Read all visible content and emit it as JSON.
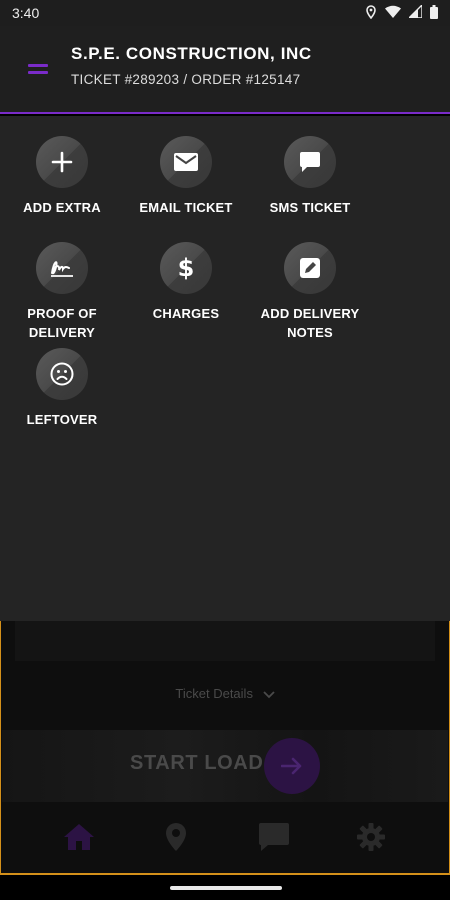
{
  "status_bar": {
    "time": "3:40"
  },
  "header": {
    "company": "S.P.E. CONSTRUCTION, INC",
    "ticket_line": "TICKET #289203 / ORDER #125147"
  },
  "actions": [
    {
      "label": "ADD EXTRA",
      "icon": "plus-icon"
    },
    {
      "label": "EMAIL TICKET",
      "icon": "envelope-icon"
    },
    {
      "label": "SMS TICKET",
      "icon": "chat-bubble-icon"
    },
    {
      "label": "PROOF OF\nDELIVERY",
      "icon": "signature-icon"
    },
    {
      "label": "CHARGES",
      "icon": "dollar-icon"
    },
    {
      "label": "ADD DELIVERY\nNOTES",
      "icon": "edit-note-icon"
    },
    {
      "label": "LEFTOVER",
      "icon": "sad-face-icon"
    }
  ],
  "background_app": {
    "ticket_details": "Ticket Details",
    "start_load": "START LOAD",
    "nav": [
      "home-icon",
      "map-pin-icon",
      "messages-icon",
      "settings-gear-icon"
    ]
  },
  "colors": {
    "accent": "#7a2bc9",
    "panel": "#242424",
    "header": "#1f1f1f",
    "outline": "#d4901a"
  }
}
